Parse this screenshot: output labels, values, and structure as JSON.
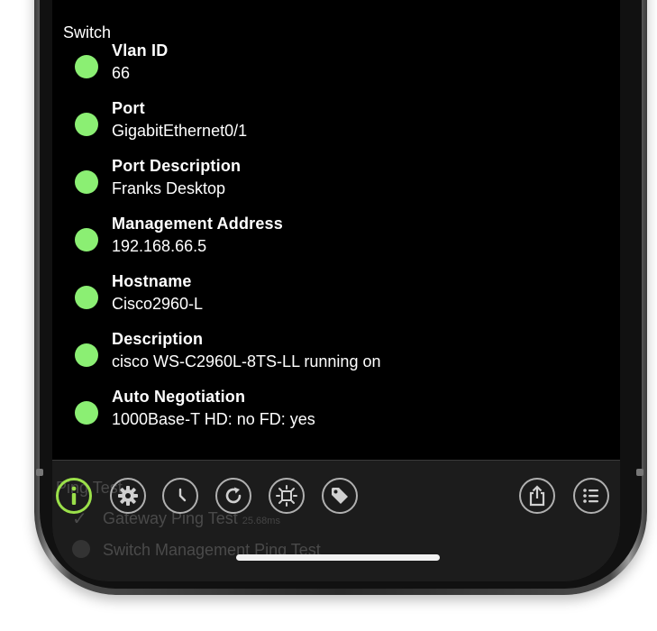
{
  "section": {
    "title": "Switch"
  },
  "items": [
    {
      "label": "Vlan ID",
      "value": "66"
    },
    {
      "label": "Port",
      "value": "GigabitEthernet0/1"
    },
    {
      "label": "Port Description",
      "value": "Franks Desktop"
    },
    {
      "label": "Management Address",
      "value": "192.168.66.5"
    },
    {
      "label": "Hostname",
      "value": "Cisco2960-L"
    },
    {
      "label": "Description",
      "value": "cisco WS-C2960L-8TS-LL running on"
    },
    {
      "label": "Auto Negotiation",
      "value": "1000Base-T HD: no FD: yes"
    }
  ],
  "background_list": {
    "header_partial": "Ping Test",
    "gateway": {
      "label": "Gateway Ping Test",
      "time": "25.68ms"
    },
    "switch": {
      "label": "Switch Management Ping Test"
    }
  },
  "toolbar": {
    "icons": [
      "info-icon",
      "gear-icon",
      "clock-icon",
      "refresh-icon",
      "brightness-icon",
      "tag-icon",
      "share-icon",
      "list-icon"
    ],
    "active": "info-icon"
  },
  "colors": {
    "status_dot": "#8bef73",
    "active_accent": "#9be04a",
    "screen_bg": "#000000",
    "toolbar_bg": "#1c1c1c"
  }
}
